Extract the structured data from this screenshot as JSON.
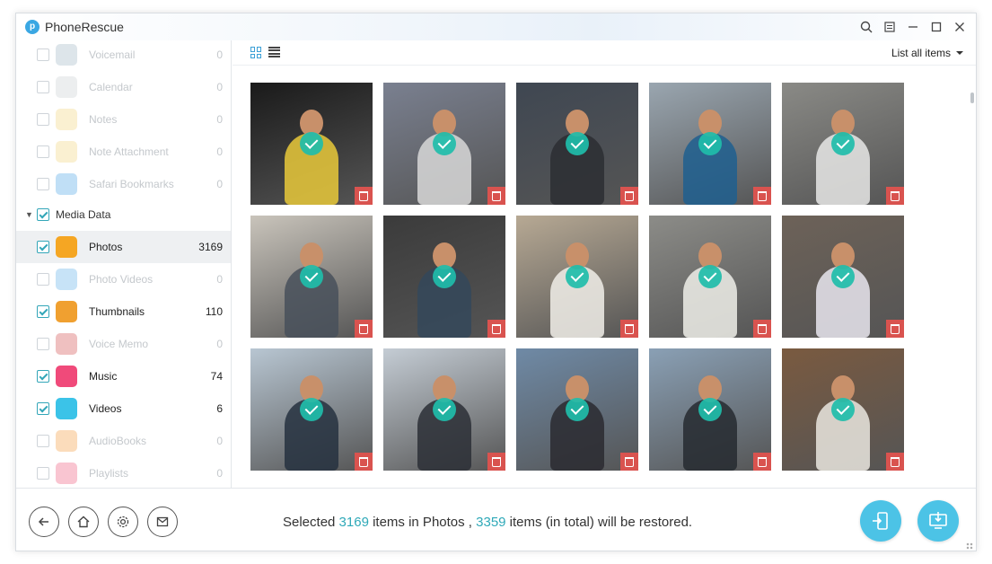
{
  "app": {
    "title": "PhoneRescue",
    "logo_letter": "p"
  },
  "sidebar": {
    "items_top": [
      {
        "label": "Voicemail",
        "count": "0",
        "icon": "voicemail-icon",
        "color": "#9fb4c4"
      },
      {
        "label": "Calendar",
        "count": "0",
        "icon": "calendar-icon",
        "color": "#c9cdd1"
      },
      {
        "label": "Notes",
        "count": "0",
        "icon": "notes-icon",
        "color": "#f2d47a"
      },
      {
        "label": "Note Attachment",
        "count": "0",
        "icon": "note-attachment-icon",
        "color": "#f2d47a"
      },
      {
        "label": "Safari Bookmarks",
        "count": "0",
        "icon": "safari-icon",
        "color": "#4aa3e6"
      }
    ],
    "group": {
      "label": "Media Data"
    },
    "items_media": [
      {
        "label": "Photos",
        "count": "3169",
        "checked": true,
        "icon": "photos-icon",
        "color": "#f5a623"
      },
      {
        "label": "Photo Videos",
        "count": "0",
        "checked": false,
        "icon": "photo-videos-icon",
        "color": "#5fb0e8"
      },
      {
        "label": "Thumbnails",
        "count": "110",
        "checked": true,
        "icon": "thumbnails-icon",
        "color": "#f0a030"
      },
      {
        "label": "Voice Memo",
        "count": "0",
        "checked": false,
        "icon": "voice-memo-icon",
        "color": "#d24b4b"
      },
      {
        "label": "Music",
        "count": "74",
        "checked": true,
        "icon": "music-icon",
        "color": "#f04a7a"
      },
      {
        "label": "Videos",
        "count": "6",
        "checked": true,
        "icon": "videos-icon",
        "color": "#3bc3e8"
      },
      {
        "label": "AudioBooks",
        "count": "0",
        "checked": false,
        "icon": "audiobooks-icon",
        "color": "#f39a3c"
      },
      {
        "label": "Playlists",
        "count": "0",
        "checked": false,
        "icon": "playlists-icon",
        "color": "#ee5a7a"
      }
    ]
  },
  "toolbar": {
    "filter_label": "List all items"
  },
  "status": {
    "prefix": "Selected ",
    "selected_count": "3169",
    "middle": " items in Photos , ",
    "total_count": "3359",
    "suffix": " items (in total) will be restored."
  },
  "photos": [
    {
      "bg": "#1a1a1a",
      "fill": "#e9c93a"
    },
    {
      "bg": "#7a8090",
      "fill": "#d8d8d8"
    },
    {
      "bg": "#3f4752",
      "fill": "#2b2e33"
    },
    {
      "bg": "#9aa6b0",
      "fill": "#1f5f8f"
    },
    {
      "bg": "#8a8a86",
      "fill": "#e8e8e6"
    },
    {
      "bg": "#c9c4bb",
      "fill": "#48505a"
    },
    {
      "bg": "#3b3b3b",
      "fill": "#34485a"
    },
    {
      "bg": "#b7a994",
      "fill": "#f1efe9"
    },
    {
      "bg": "#8c8c88",
      "fill": "#efeee9"
    },
    {
      "bg": "#6d6258",
      "fill": "#e9e6ee"
    },
    {
      "bg": "#b8c6d2",
      "fill": "#263140"
    },
    {
      "bg": "#c4ccd4",
      "fill": "#2c2f36"
    },
    {
      "bg": "#6f8aa6",
      "fill": "#2a2a30"
    },
    {
      "bg": "#8aa0b5",
      "fill": "#262a30"
    },
    {
      "bg": "#7a5a40",
      "fill": "#eae6df"
    }
  ]
}
